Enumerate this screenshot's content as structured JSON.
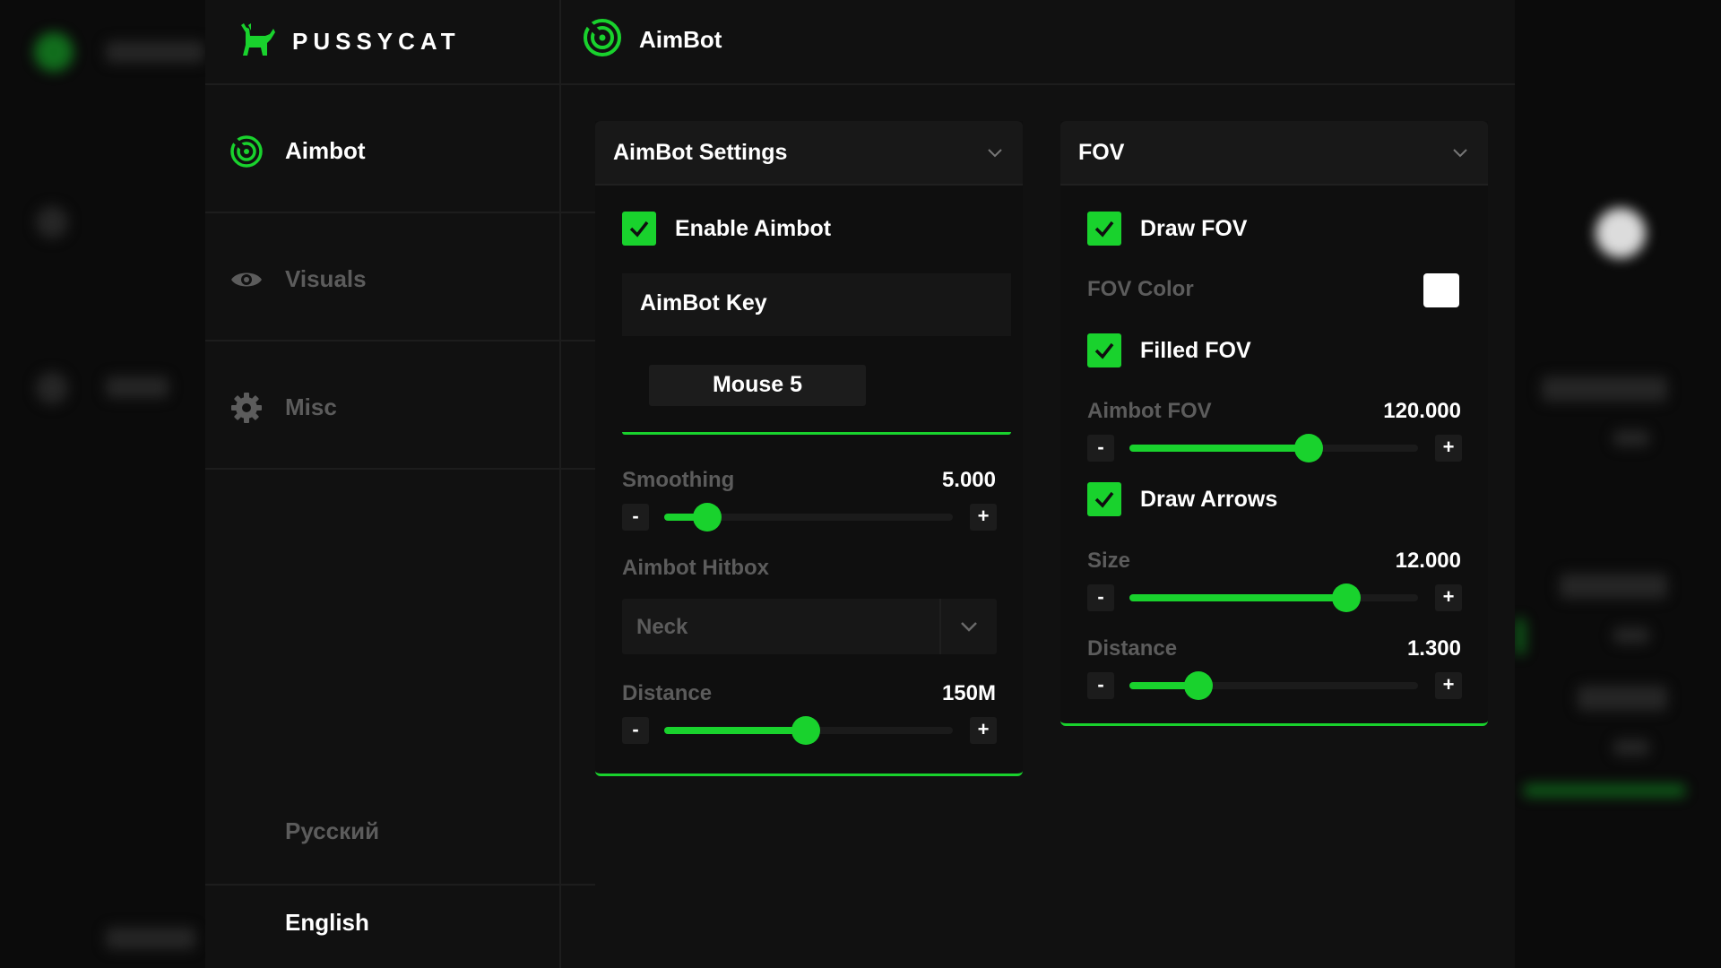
{
  "brand": {
    "name": "PUSSYCAT"
  },
  "header": {
    "title": "AimBot"
  },
  "sidebar": {
    "items": [
      {
        "label": "Aimbot",
        "active": true,
        "icon": "radar-icon"
      },
      {
        "label": "Visuals",
        "active": false,
        "icon": "eye-icon"
      },
      {
        "label": "Misc",
        "active": false,
        "icon": "gear-icon"
      }
    ],
    "languages": [
      {
        "label": "Русский",
        "active": false
      },
      {
        "label": "English",
        "active": true
      }
    ]
  },
  "aimbot_panel": {
    "title": "AimBot Settings",
    "enable_aimbot": {
      "label": "Enable Aimbot",
      "checked": true
    },
    "key": {
      "label": "AimBot Key",
      "value": "Mouse 5"
    },
    "smoothing": {
      "label": "Smoothing",
      "value_text": "5.000",
      "fraction": 0.15
    },
    "hitbox": {
      "label": "Aimbot Hitbox",
      "value": "Neck"
    },
    "distance": {
      "label": "Distance",
      "value_text": "150M",
      "fraction": 0.49
    }
  },
  "fov_panel": {
    "title": "FOV",
    "draw_fov": {
      "label": "Draw FOV",
      "checked": true
    },
    "fov_color": {
      "label": "FOV Color",
      "color": "#ffffff"
    },
    "filled_fov": {
      "label": "Filled FOV",
      "checked": true
    },
    "aimbot_fov": {
      "label": "Aimbot FOV",
      "value_text": "120.000",
      "fraction": 0.62
    },
    "draw_arrows": {
      "label": "Draw Arrows",
      "checked": true
    },
    "size": {
      "label": "Size",
      "value_text": "12.000",
      "fraction": 0.75
    },
    "distance": {
      "label": "Distance",
      "value_text": "1.300",
      "fraction": 0.24
    }
  },
  "stepper": {
    "minus": "-",
    "plus": "+"
  },
  "colors": {
    "accent": "#19d22d",
    "panel": "#0f0f0f",
    "muted_text": "#5c5c5c"
  }
}
